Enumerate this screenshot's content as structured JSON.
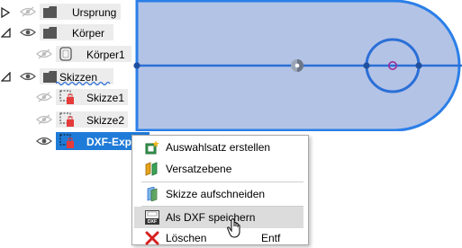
{
  "tree": {
    "ursprung": "Ursprung",
    "koerper": "Körper",
    "koerper1": "Körper1",
    "skizzen": "Skizzen",
    "skizze1": "Skizze1",
    "skizze2": "Skizze2",
    "dxf_export": "DXF-Export"
  },
  "context_menu": {
    "items": [
      {
        "label": "Auswahlsatz erstellen",
        "icon": "selection-set-icon"
      },
      {
        "label": "Versatzebene",
        "icon": "offset-plane-icon"
      },
      {
        "label": "Skizze aufschneiden",
        "icon": "slice-sketch-icon"
      },
      {
        "label": "Als DXF speichern",
        "icon": "dxf-icon"
      },
      {
        "label": "Löschen",
        "icon": "delete-icon",
        "shortcut": "Entf"
      }
    ]
  },
  "colors": {
    "selection": "#1f7bd8",
    "sketch_fill": "#b3c3e6",
    "sketch_line": "#2b7fe8",
    "hole_center": "#9b2c9b",
    "delete_red": "#d62020"
  }
}
